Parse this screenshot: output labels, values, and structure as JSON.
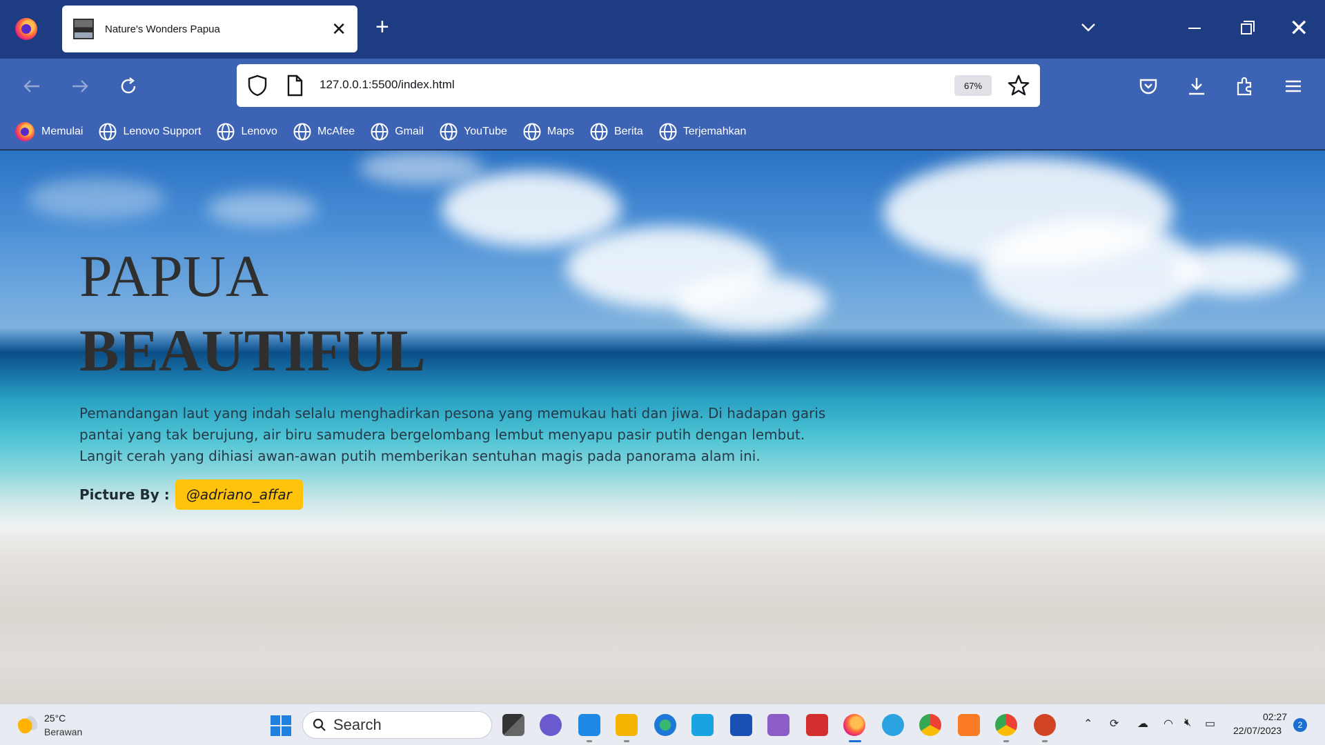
{
  "browser": {
    "tab_title": "Nature's Wonders Papua",
    "url": "127.0.0.1:5500/index.html",
    "zoom": "67%"
  },
  "bookmarks": [
    "Memulai",
    "Lenovo Support",
    "Lenovo",
    "McAfee",
    "Gmail",
    "YouTube",
    "Maps",
    "Berita",
    "Terjemahkan"
  ],
  "hero": {
    "title_line1": "PAPUA",
    "title_line2": "BEAUTIFUL",
    "description": "Pemandangan laut yang indah selalu menghadirkan pesona yang memukau hati dan jiwa. Di hadapan garis pantai yang tak berujung, air biru samudera bergelombang lembut menyapu pasir putih dengan lembut. Langit cerah yang dihiasi awan-awan putih memberikan sentuhan magis pada panorama alam ini.",
    "credit_label": "Picture By :",
    "credit_handle": "@adriano_affar"
  },
  "taskbar": {
    "temperature": "25°C",
    "weather": "Berawan",
    "search_label": "Search",
    "time": "02:27",
    "date": "22/07/2023",
    "notification_count": "2"
  },
  "colors": {
    "titlebar": "#1e3c82",
    "navbar": "#3d63b4",
    "credit_button": "#ffc30b"
  }
}
